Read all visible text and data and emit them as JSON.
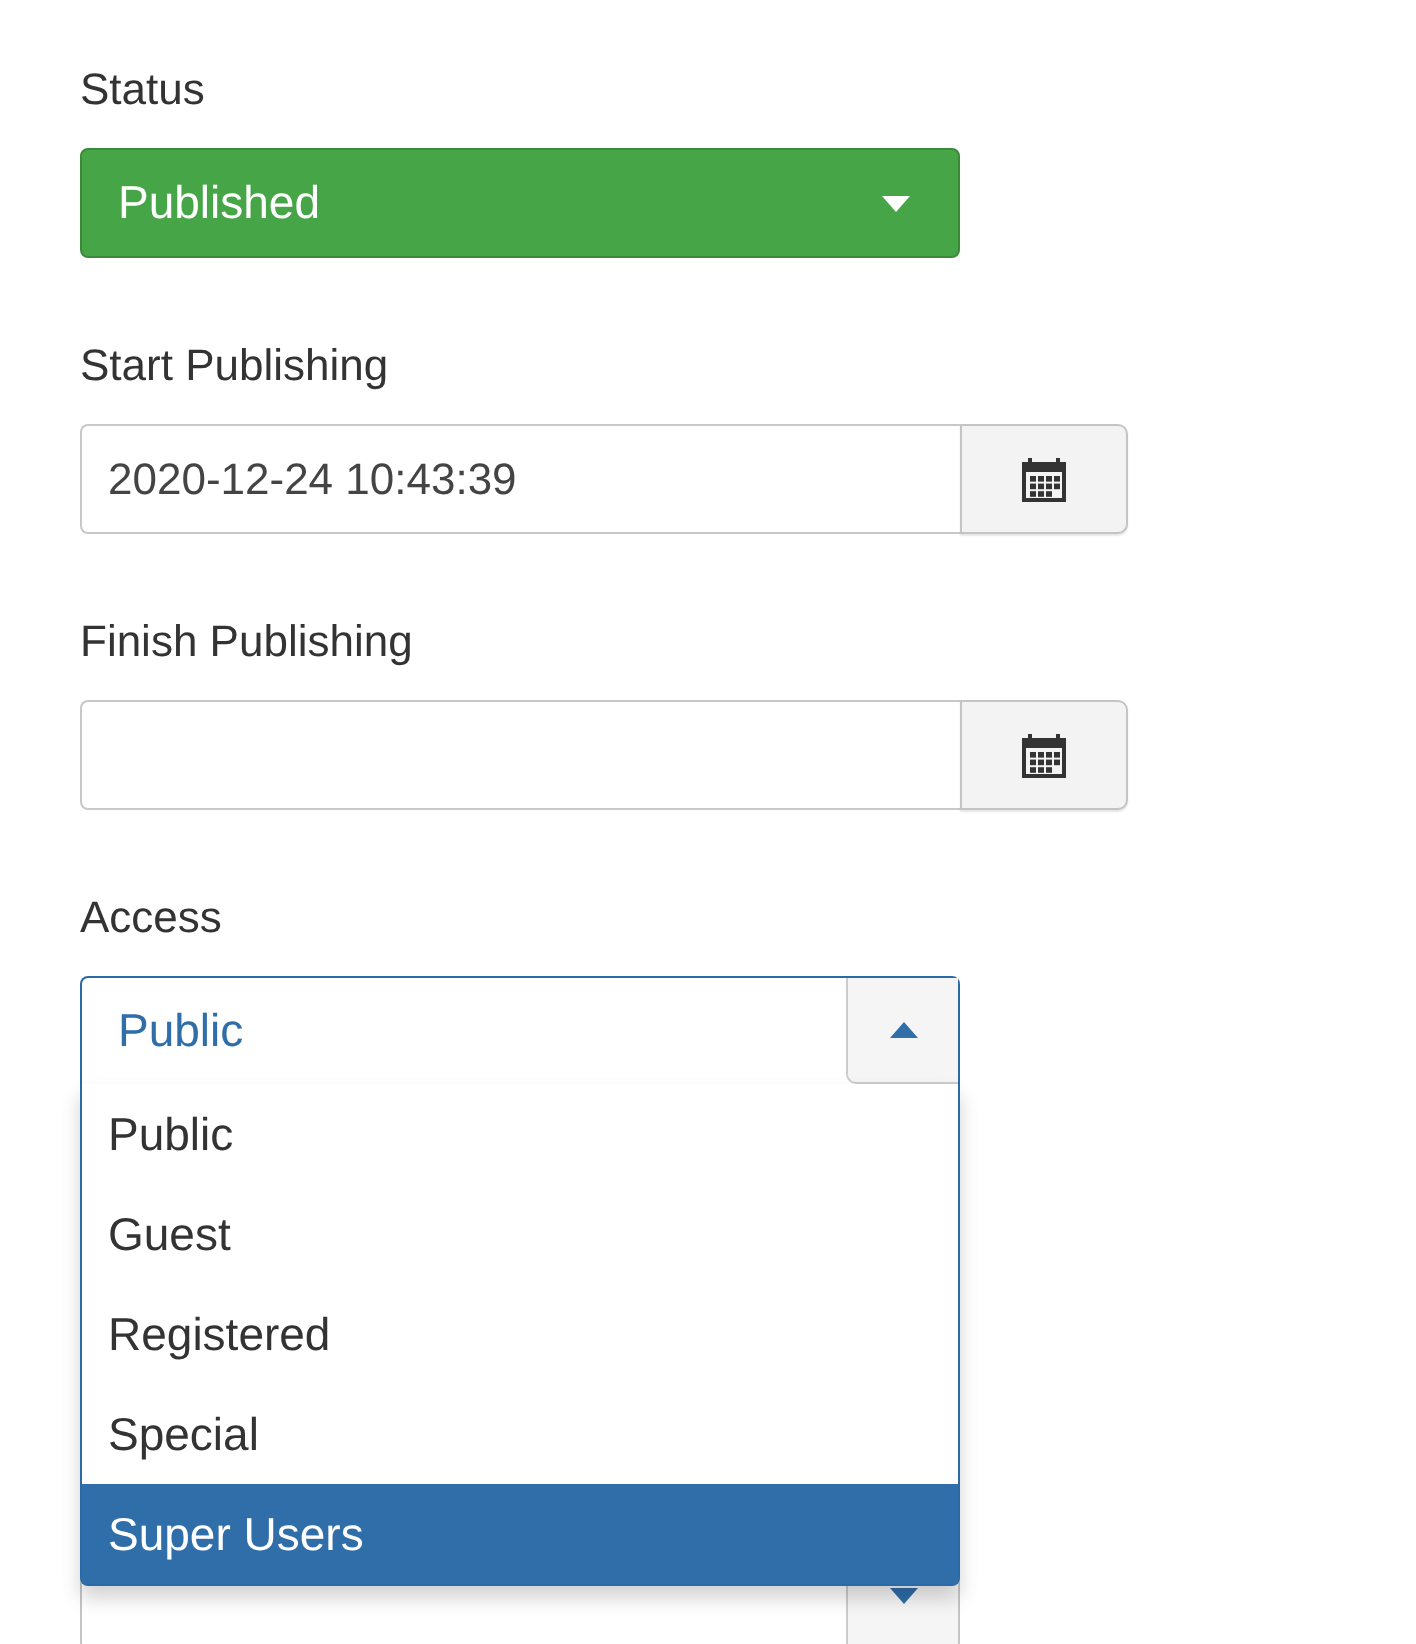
{
  "fields": [
    {
      "kind": "status-select",
      "label": "Status",
      "value": "Published"
    },
    {
      "kind": "date",
      "label": "Start Publishing",
      "value": "2020-12-24 10:43:39"
    },
    {
      "kind": "date",
      "label": "Finish Publishing"
    },
    {
      "kind": "select",
      "label": "Access",
      "value": "Public",
      "expanded": true,
      "options": [
        {
          "label": "Public",
          "highlighted": false
        },
        {
          "label": "Guest",
          "highlighted": false
        },
        {
          "label": "Registered",
          "highlighted": false
        },
        {
          "label": "Special",
          "highlighted": false
        },
        {
          "label": "Super Users",
          "highlighted": true
        }
      ]
    },
    {
      "kind": "select",
      "expanded": false
    }
  ]
}
